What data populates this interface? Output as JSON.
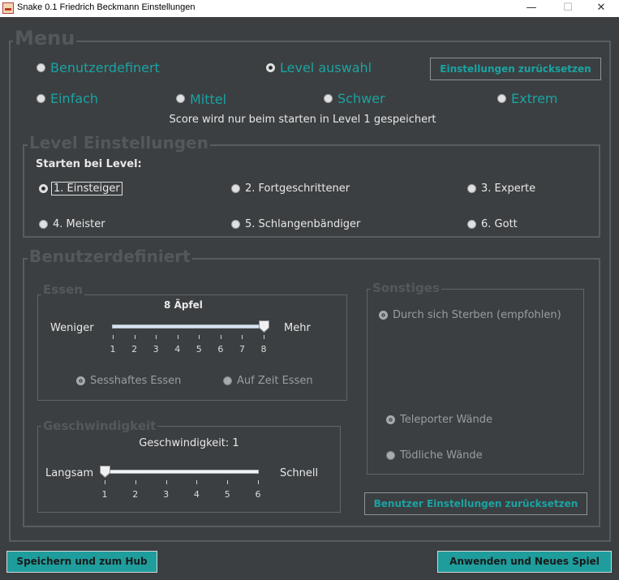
{
  "window": {
    "title": "Snake 0.1 Friedrich Beckmann Einstellungen",
    "minimize": "—",
    "maximize": "☐",
    "close": "✕"
  },
  "menu": {
    "legend": "Menu",
    "radios": {
      "benutzerdefiniert": "Benutzerdefinert",
      "level_auswahl": "Level auswahl",
      "einfach": "Einfach",
      "mittel": "Mittel",
      "schwer": "Schwer",
      "extrem": "Extrem"
    },
    "selected": "level_auswahl",
    "reset_button": "Einstellungen zurücksetzen",
    "score_note": "Score wird nur beim starten in Level 1 gespeichert"
  },
  "level": {
    "legend": "Level Einstellungen",
    "start_label": "Starten bei Level:",
    "options": [
      "1. Einsteiger",
      "2. Fortgeschrittener",
      "3. Experte",
      "4. Meister",
      "5. Schlangenbändiger",
      "6. Gott"
    ],
    "selected_index": 0
  },
  "custom": {
    "legend": "Benutzerdefiniert",
    "essen": {
      "legend": "Essen",
      "value_label": "8 Äpfel",
      "left": "Weniger",
      "right": "Mehr",
      "ticks": [
        "1",
        "2",
        "3",
        "4",
        "5",
        "6",
        "7",
        "8"
      ],
      "min": 1,
      "max": 8,
      "value": 8,
      "mode_sesshaft": "Sesshaftes Essen",
      "mode_zeit": "Auf Zeit Essen",
      "mode_selected": "sesshaft"
    },
    "speed": {
      "legend": "Geschwindigkeit",
      "value_label": "Geschwindigkeit: 1",
      "left": "Langsam",
      "right": "Schnell",
      "ticks": [
        "1",
        "2",
        "3",
        "4",
        "5",
        "6"
      ],
      "min": 1,
      "max": 6,
      "value": 1
    },
    "sonstiges": {
      "legend": "Sonstiges",
      "sterben": "Durch sich Sterben (empfohlen)",
      "teleporter": "Teleporter Wände",
      "toedlich": "Tödliche Wände",
      "wall_selected": "teleporter"
    },
    "reset_button": "Benutzer Einstellungen zurücksetzen"
  },
  "footer": {
    "save_hub": "Speichern und zum Hub",
    "apply_new": "Anwenden und Neues Spiel"
  },
  "colors": {
    "background": "#3c3f41",
    "accent": "#1aa3a3",
    "button_fill": "#1f9c9c"
  }
}
